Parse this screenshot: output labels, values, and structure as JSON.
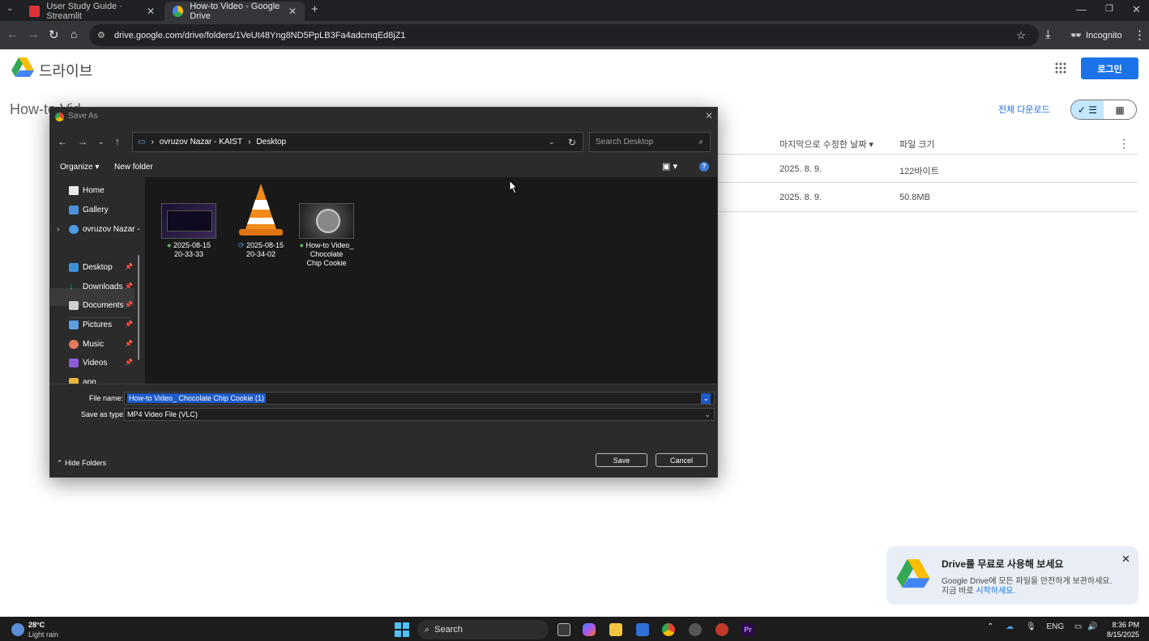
{
  "browser": {
    "tabs": [
      {
        "title": "User Study Guide · Streamlit",
        "active": false,
        "icon": "streamlit-icon"
      },
      {
        "title": "How-to Video - Google Drive",
        "active": true,
        "icon": "google-drive-icon"
      }
    ],
    "url": "drive.google.com/drive/folders/1VeUt48Yng8ND5PpLB3Fa4adcmqEd8jZ1",
    "incognito_label": "Incognito"
  },
  "drive": {
    "app_name": "드라이브",
    "login_label": "로그인",
    "folder_title": "How-to Vid",
    "download_all": "전체 다운로드",
    "columns": {
      "modified": "마지막으로 수정한 날짜",
      "size": "파일 크기"
    },
    "rows": [
      {
        "modified": "2025. 8. 9.",
        "size": "122바이트"
      },
      {
        "modified": "2025. 8. 9.",
        "size": "50.8MB"
      }
    ],
    "promo": {
      "title": "Drive를 무료로 사용해 보세요",
      "line1": "Google Drive에 모든 파일을 안전하게 보관하세요.",
      "line2_prefix": "지금 바로 ",
      "line2_link": "시작하세요."
    }
  },
  "dialog": {
    "title": "Save As",
    "path": [
      "ovruzov Nazar - KAIST",
      "Desktop"
    ],
    "search_placeholder": "Search Desktop",
    "organize": "Organize",
    "new_folder": "New folder",
    "sidebar": [
      {
        "label": "Home",
        "pinned": false
      },
      {
        "label": "Gallery",
        "pinned": false
      },
      {
        "label": "ovruzov Nazar -",
        "pinned": false
      },
      {
        "label": "Desktop",
        "pinned": true
      },
      {
        "label": "Downloads",
        "pinned": true
      },
      {
        "label": "Documents",
        "pinned": true
      },
      {
        "label": "Pictures",
        "pinned": true
      },
      {
        "label": "Music",
        "pinned": true
      },
      {
        "label": "Videos",
        "pinned": true
      },
      {
        "label": "app",
        "pinned": false
      }
    ],
    "files": [
      {
        "line1": "2025-08-15",
        "line2": "20-33-33",
        "line3": "",
        "status": "synced"
      },
      {
        "line1": "2025-08-15",
        "line2": "20-34-02",
        "line3": "",
        "status": "syncing"
      },
      {
        "line1": "How-to Video_",
        "line2": "Chocolate",
        "line3": "Chip Cookie",
        "status": "synced"
      }
    ],
    "file_name_label": "File name:",
    "file_name_value": "How-to Video_ Chocolate Chip Cookie (1)",
    "save_type_label": "Save as type:",
    "save_type_value": "MP4 Video File (VLC)",
    "hide_folders": "Hide Folders",
    "save_label": "Save",
    "cancel_label": "Cancel"
  },
  "taskbar": {
    "temperature": "28°C",
    "weather": "Light rain",
    "search_label": "Search",
    "language": "ENG",
    "time": "8:36 PM",
    "date": "8/15/2025"
  },
  "colors": {
    "accent": "#1a73e8",
    "selection": "#1e5ac8",
    "dialog_bg": "#2b2b2b"
  }
}
